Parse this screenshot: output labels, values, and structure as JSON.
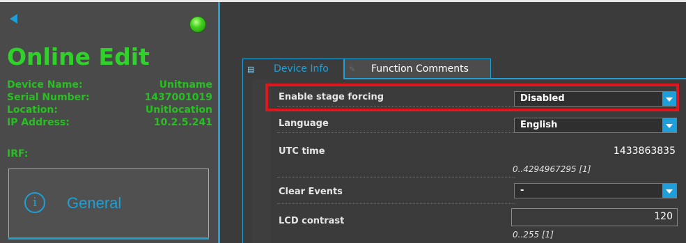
{
  "left": {
    "title": "Online Edit",
    "fields": [
      {
        "label": "Device Name:",
        "value": "Unitname"
      },
      {
        "label": "Serial Number:",
        "value": "1437001019"
      },
      {
        "label": "Location:",
        "value": "Unitlocation"
      },
      {
        "label": "IP Address:",
        "value": "10.2.5.241"
      }
    ],
    "irf_label": "IRF:",
    "general_label": "General",
    "general_icon": "i"
  },
  "tabs": [
    {
      "label": "Device Info",
      "icon": "device-info-icon",
      "active": true
    },
    {
      "label": "Function Comments",
      "icon": "comments-icon",
      "active": false
    }
  ],
  "properties": {
    "stage_forcing": {
      "label": "Enable stage forcing",
      "value": "Disabled"
    },
    "language": {
      "label": "Language",
      "value": "English"
    },
    "utc_time": {
      "label": "UTC time",
      "value": "1433863835",
      "range": "0..4294967295 [1]"
    },
    "clear_events": {
      "label": "Clear Events",
      "value": "-"
    },
    "lcd_contrast": {
      "label": "LCD contrast",
      "value": "120",
      "range": "0..255 [1]"
    }
  },
  "colors": {
    "accent": "#1ea0d6",
    "status_green": "#2fd12a",
    "highlight_red": "#e0161c"
  }
}
